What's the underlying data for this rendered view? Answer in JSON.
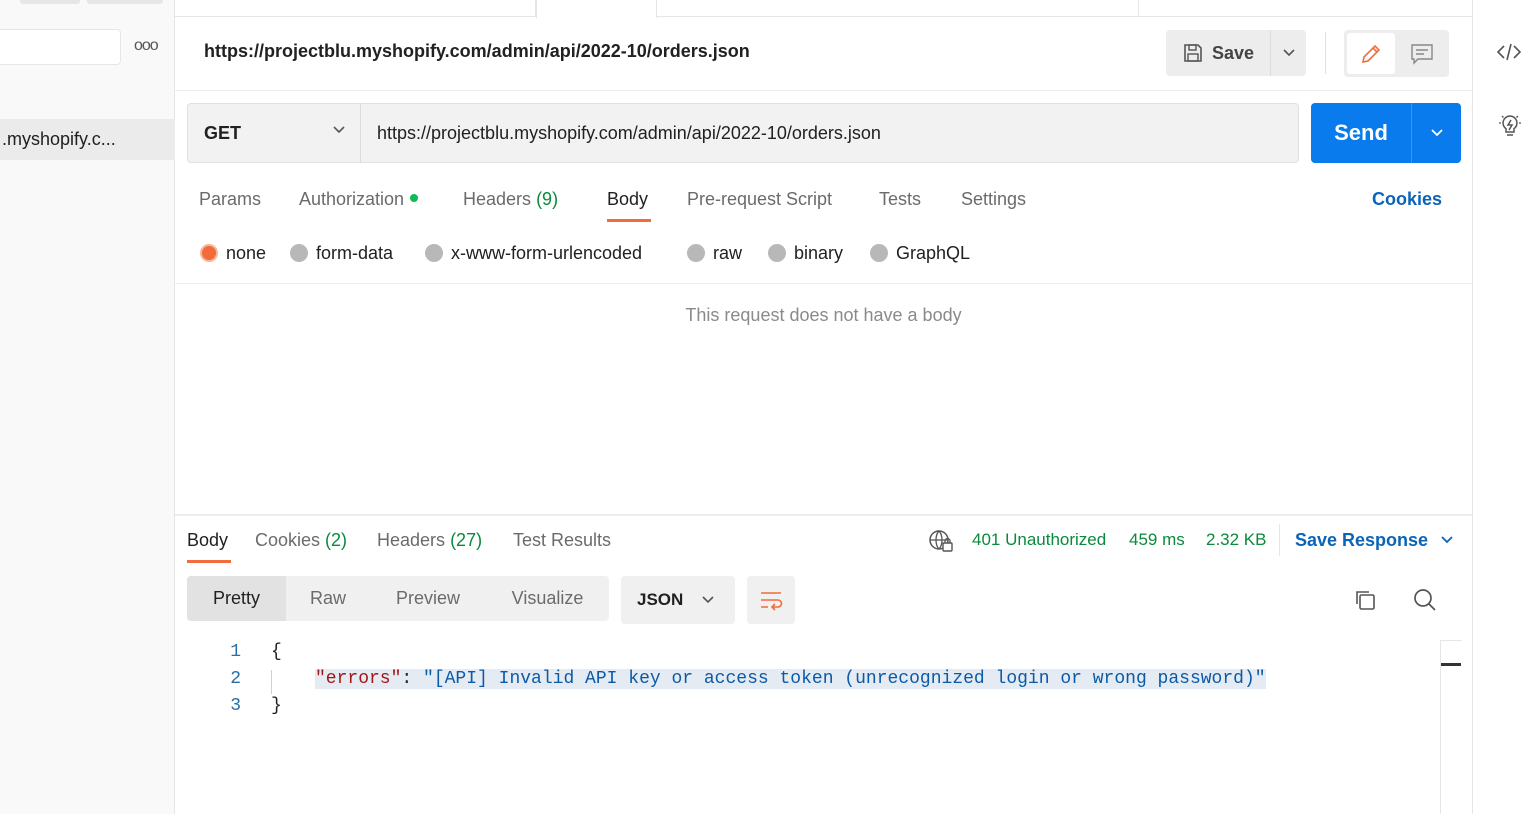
{
  "sidebar": {
    "selected_item": ".myshopify.c...",
    "more_label": "ooo"
  },
  "header": {
    "title": "https://projectblu.myshopify.com/admin/api/2022-10/orders.json",
    "save_label": "Save"
  },
  "request": {
    "method": "GET",
    "url": "https://projectblu.myshopify.com/admin/api/2022-10/orders.json",
    "send_label": "Send"
  },
  "request_tabs": {
    "params": "Params",
    "authorization": "Authorization",
    "headers": "Headers",
    "headers_count": "(9)",
    "body": "Body",
    "pre_request": "Pre-request Script",
    "tests": "Tests",
    "settings": "Settings",
    "cookies": "Cookies"
  },
  "body_types": {
    "none": "none",
    "form_data": "form-data",
    "urlencoded": "x-www-form-urlencoded",
    "raw": "raw",
    "binary": "binary",
    "graphql": "GraphQL",
    "selected": "none"
  },
  "body_empty_message": "This request does not have a body",
  "response_tabs": {
    "body": "Body",
    "cookies": "Cookies",
    "cookies_count": "(2)",
    "headers": "Headers",
    "headers_count": "(27)",
    "test_results": "Test Results"
  },
  "response_status": {
    "status": "401 Unauthorized",
    "time": "459 ms",
    "size": "2.32 KB",
    "save_response": "Save Response"
  },
  "response_view": {
    "pretty": "Pretty",
    "raw": "Raw",
    "preview": "Preview",
    "visualize": "Visualize",
    "format": "JSON"
  },
  "response_body": {
    "line_numbers": [
      "1",
      "2",
      "3"
    ],
    "open_brace": "{",
    "key": "\"errors\"",
    "colon": ": ",
    "value": "\"[API] Invalid API key or access token (unrecognized login or wrong password)\"",
    "close_brace": "}"
  },
  "colors": {
    "accent": "#f26b3a",
    "send_blue": "#097bed",
    "link_blue": "#0a64b8",
    "status_green": "#0a8a3c"
  }
}
